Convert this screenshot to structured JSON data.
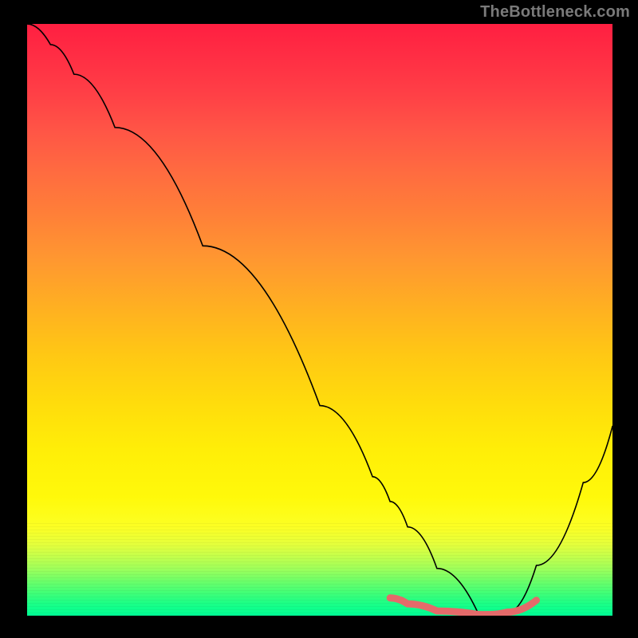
{
  "watermark": "TheBottleneck.com",
  "chart_data": {
    "type": "line",
    "title": "",
    "xlabel": "",
    "ylabel": "",
    "xlim": [
      0,
      1000
    ],
    "ylim": [
      0,
      1000
    ],
    "grid": false,
    "legend": null,
    "series": [
      {
        "name": "bottleneck-curve",
        "x": [
          0,
          40,
          80,
          150,
          300,
          500,
          590,
          620,
          650,
          700,
          770,
          790,
          820,
          870,
          950,
          1000
        ],
        "values": [
          1000,
          965,
          915,
          825,
          625,
          355,
          235,
          193,
          150,
          80,
          5,
          2,
          5,
          85,
          225,
          320
        ]
      }
    ],
    "highlight": {
      "name": "optimal-band",
      "x": [
        620,
        650,
        700,
        770,
        790,
        820,
        870
      ],
      "values": [
        30,
        20,
        8,
        2,
        2,
        6,
        26
      ],
      "color": "#e46a6a",
      "stroke_width": 12
    }
  },
  "colors": {
    "background": "#000000",
    "curve": "#000000",
    "highlight": "#e46a6a",
    "watermark": "#7a7a7a"
  }
}
